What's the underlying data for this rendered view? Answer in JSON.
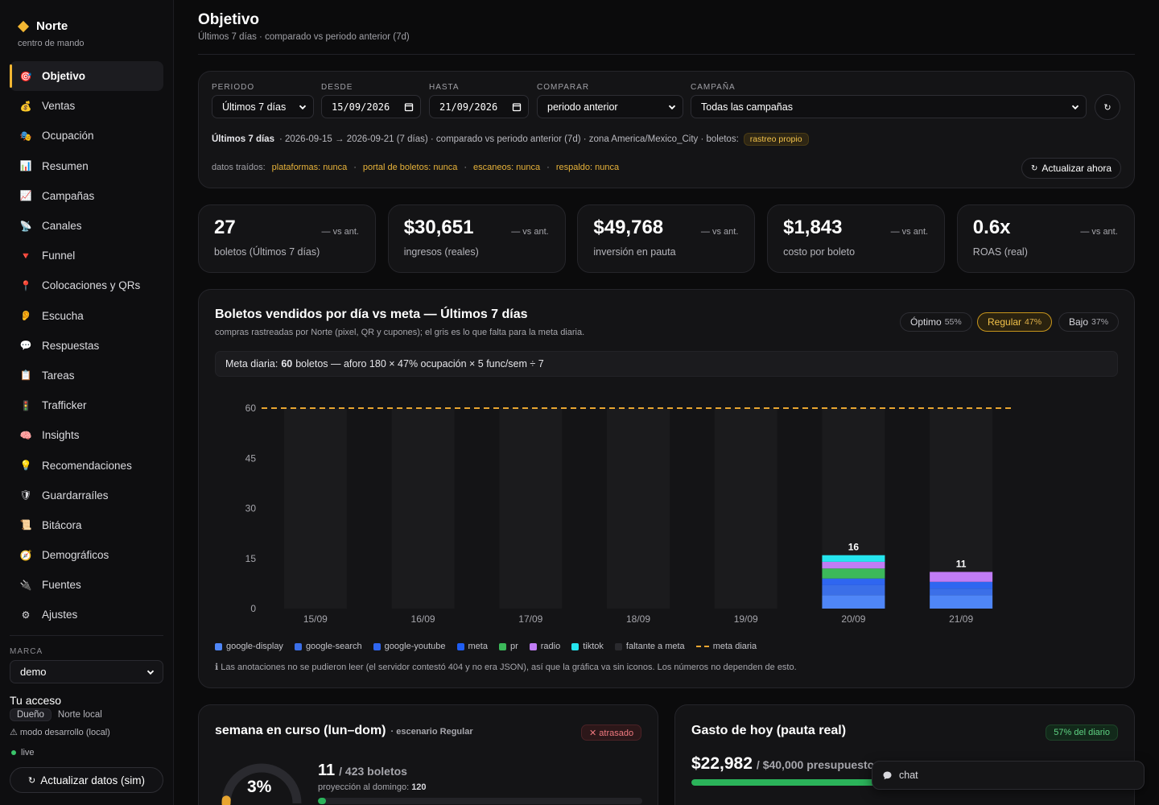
{
  "brand": {
    "name": "Norte",
    "subtitle": "centro de mando"
  },
  "nav": [
    {
      "label": "Objetivo",
      "icon": "🎯",
      "active": true
    },
    {
      "label": "Ventas",
      "icon": "💰"
    },
    {
      "label": "Ocupación",
      "icon": "🎭"
    },
    {
      "label": "Resumen",
      "icon": "📊"
    },
    {
      "label": "Campañas",
      "icon": "📈"
    },
    {
      "label": "Canales",
      "icon": "📡"
    },
    {
      "label": "Funnel",
      "icon": "🔻"
    },
    {
      "label": "Colocaciones y QRs",
      "icon": "📍"
    },
    {
      "label": "Escucha",
      "icon": "👂"
    },
    {
      "label": "Respuestas",
      "icon": "💬"
    },
    {
      "label": "Tareas",
      "icon": "📋"
    },
    {
      "label": "Trafficker",
      "icon": "🚦"
    },
    {
      "label": "Insights",
      "icon": "🧠"
    },
    {
      "label": "Recomendaciones",
      "icon": "💡"
    },
    {
      "label": "Guardarraíles",
      "icon": "🛡"
    },
    {
      "label": "Bitácora",
      "icon": "📜"
    },
    {
      "label": "Demográficos",
      "icon": "🧭"
    },
    {
      "label": "Fuentes",
      "icon": "🔌"
    },
    {
      "label": "Ajustes",
      "icon": "⚙"
    }
  ],
  "sidebar_bottom": {
    "marca_label": "MARCA",
    "marca_value": "demo",
    "acceso_title": "Tu acceso",
    "role": "Dueño",
    "org": "Norte local",
    "modo": "⚠ modo desarrollo (local)",
    "live": "live",
    "refresh_label": "Actualizar datos (sim)"
  },
  "header": {
    "title": "Objetivo",
    "subtitle": "Últimos 7 días · comparado vs periodo anterior (7d)"
  },
  "filters": {
    "periodo": {
      "label": "PERIODO",
      "value": "Últimos 7 días"
    },
    "desde": {
      "label": "DESDE",
      "value": "15/09/2026"
    },
    "hasta": {
      "label": "HASTA",
      "value": "21/09/2026"
    },
    "comparar": {
      "label": "COMPARAR",
      "value": "periodo anterior"
    },
    "campana": {
      "label": "CAMPAÑA",
      "value": "Todas las campañas"
    },
    "info_bold": "Últimos 7 días",
    "info_text": "· 2026-09-15 → 2026-09-21 (7 días) · comparado vs periodo anterior (7d) · zona America/Mexico_City · boletos:",
    "info_badge": "rastreo propio",
    "fetch_label": "datos traídos:",
    "fetch_items": [
      "plataformas: nunca",
      "portal de boletos: nunca",
      "escaneos: nunca",
      "respaldo: nunca"
    ],
    "fetch_sep": "·",
    "update_label": "Actualizar ahora"
  },
  "kpis": [
    {
      "value": "27",
      "delta": "— vs ant.",
      "label": "boletos (Últimos 7 días)"
    },
    {
      "value": "$30,651",
      "delta": "— vs ant.",
      "label": "ingresos (reales)"
    },
    {
      "value": "$49,768",
      "delta": "— vs ant.",
      "label": "inversión en pauta"
    },
    {
      "value": "$1,843",
      "delta": "— vs ant.",
      "label": "costo por boleto"
    },
    {
      "value": "0.6x",
      "delta": "— vs ant.",
      "label": "ROAS (real)"
    }
  ],
  "chart_card": {
    "title": "Boletos vendidos por día vs meta — Últimos 7 días",
    "subtitle": "compras rastreadas por Norte (pixel, QR y cupones); el gris es lo que falta para la meta diaria.",
    "scenarios": [
      {
        "name": "Óptimo",
        "pct": "55%"
      },
      {
        "name": "Regular",
        "pct": "47%",
        "selected": true
      },
      {
        "name": "Bajo",
        "pct": "37%"
      }
    ],
    "meta_prefix": "Meta diaria:",
    "meta_value": "60",
    "meta_suffix": "boletos — aforo 180 × 47% ocupación × 5 func/sem ÷ 7",
    "note": "ℹ Las anotaciones no se pudieron leer (el servidor contestó 404 y no era JSON), así que la gráfica va sin iconos. Los números no dependen de esto."
  },
  "chart_data": {
    "type": "bar",
    "stacked": true,
    "categories": [
      "15/09",
      "16/09",
      "17/09",
      "18/09",
      "19/09",
      "20/09",
      "21/09"
    ],
    "ylim": [
      0,
      60
    ],
    "yticks": [
      0,
      15,
      30,
      45,
      60
    ],
    "meta_line": 60,
    "totals": [
      0,
      0,
      0,
      0,
      0,
      16,
      11
    ],
    "series": [
      {
        "name": "google-display",
        "color": "#4f86f7",
        "values": [
          0,
          0,
          0,
          0,
          0,
          4,
          4
        ]
      },
      {
        "name": "google-search",
        "color": "#3b6fe8",
        "values": [
          0,
          0,
          0,
          0,
          0,
          3,
          2
        ]
      },
      {
        "name": "google-youtube",
        "color": "#2f66f0",
        "values": [
          0,
          0,
          0,
          0,
          0,
          2,
          2
        ]
      },
      {
        "name": "meta",
        "color": "#1f5df2",
        "values": [
          0,
          0,
          0,
          0,
          0,
          0,
          0
        ]
      },
      {
        "name": "pr",
        "color": "#3cb95a",
        "values": [
          0,
          0,
          0,
          0,
          0,
          3,
          0
        ]
      },
      {
        "name": "radio",
        "color": "#c07cf5",
        "values": [
          0,
          0,
          0,
          0,
          0,
          2,
          3
        ]
      },
      {
        "name": "tiktok",
        "color": "#25e5ee",
        "values": [
          0,
          0,
          0,
          0,
          0,
          2,
          0
        ]
      },
      {
        "name": "faltante a meta",
        "color": "#1b1b1d",
        "values": [
          60,
          60,
          60,
          60,
          60,
          44,
          49
        ]
      }
    ],
    "meta_legend": "meta diaria",
    "meta_color": "#e8a530"
  },
  "week": {
    "title": "semana en curso (lun–dom)",
    "scenario": "· escenario Regular",
    "badge": "✕ atrasado",
    "pct_text": "3%",
    "pct": 0.03,
    "sold": "11",
    "target": "/ 423 boletos",
    "proj_label": "proyección al domingo:",
    "proj_value": "120",
    "progress": 0.026
  },
  "spend": {
    "title": "Gasto de hoy (pauta real)",
    "badge": "57% del diario",
    "value": "$22,982",
    "budget": "/ $40,000 presupuesto",
    "progress": 0.57
  },
  "chat": {
    "label": "chat"
  }
}
